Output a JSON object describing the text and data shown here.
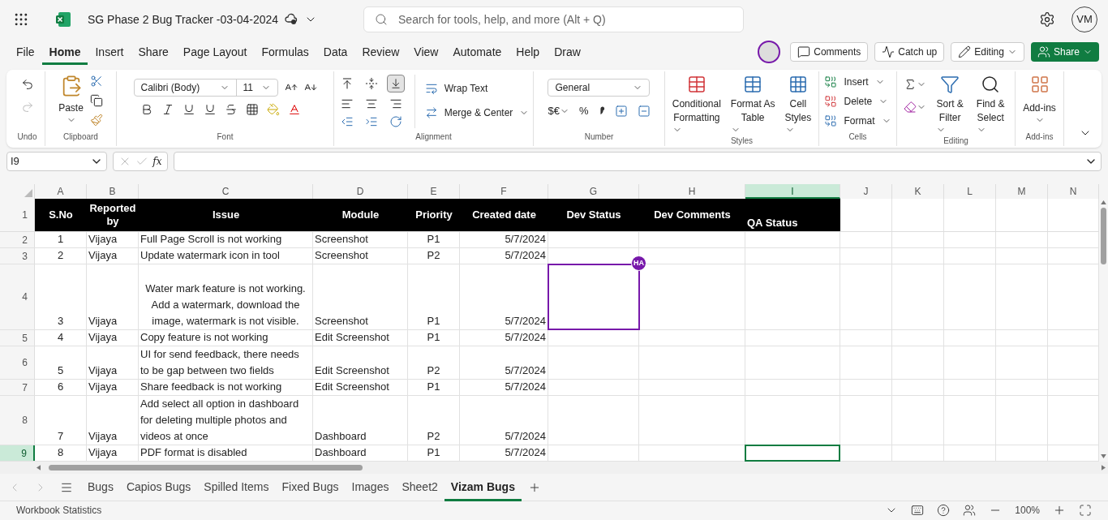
{
  "app": {
    "title": "SG Phase 2 Bug Tracker -03-04-2024",
    "search_placeholder": "Search for tools, help, and more (Alt + Q)",
    "user_initials": "VM"
  },
  "menu": [
    {
      "label": "File",
      "selected": false
    },
    {
      "label": "Home",
      "selected": true
    },
    {
      "label": "Insert",
      "selected": false
    },
    {
      "label": "Share",
      "selected": false
    },
    {
      "label": "Page Layout",
      "selected": false
    },
    {
      "label": "Formulas",
      "selected": false
    },
    {
      "label": "Data",
      "selected": false
    },
    {
      "label": "Review",
      "selected": false
    },
    {
      "label": "View",
      "selected": false
    },
    {
      "label": "Automate",
      "selected": false
    },
    {
      "label": "Help",
      "selected": false
    },
    {
      "label": "Draw",
      "selected": false
    }
  ],
  "actions": {
    "comments": "Comments",
    "catch_up": "Catch up",
    "editing": "Editing",
    "share": "Share"
  },
  "ribbon": {
    "groups": [
      "Undo",
      "Clipboard",
      "Font",
      "Alignment",
      "Number",
      "Styles",
      "Cells",
      "Editing",
      "Add-ins"
    ],
    "paste": "Paste",
    "font_name": "Calibri (Body)",
    "font_size": "11",
    "valign": [
      {
        "selected": false
      },
      {
        "selected": false
      },
      {
        "selected": true
      }
    ],
    "wrap_text": "Wrap Text",
    "merge": "Merge & Center",
    "number_format": "General",
    "currency": "$€",
    "percent": "%",
    "styles": [
      "Conditional\nFormatting",
      "Format As\nTable",
      "Cell\nStyles"
    ],
    "cells": [
      "Insert",
      "Delete",
      "Format"
    ],
    "editing": [
      "Sort &\nFilter",
      "Find &\nSelect"
    ],
    "add_ins": "Add-ins"
  },
  "formula_bar": {
    "name_box": "I9",
    "fx": "fx"
  },
  "sheet": {
    "columns": [
      {
        "letter": "A",
        "selected": false
      },
      {
        "letter": "B",
        "selected": false
      },
      {
        "letter": "C",
        "selected": false
      },
      {
        "letter": "D",
        "selected": false
      },
      {
        "letter": "E",
        "selected": false
      },
      {
        "letter": "F",
        "selected": false
      },
      {
        "letter": "G",
        "selected": false
      },
      {
        "letter": "H",
        "selected": false
      },
      {
        "letter": "I",
        "selected": true
      },
      {
        "letter": "J",
        "selected": false
      },
      {
        "letter": "K",
        "selected": false
      },
      {
        "letter": "L",
        "selected": false
      },
      {
        "letter": "M",
        "selected": false
      },
      {
        "letter": "N",
        "selected": false
      }
    ],
    "header_row": {
      "number": "1",
      "selected": false,
      "cells": [
        "S.No",
        "Reported by",
        "Issue",
        "Module",
        "Priority",
        "Created date",
        "Dev Status",
        "Dev Comments",
        "QA Status"
      ]
    },
    "rows": [
      {
        "number": "2",
        "selected": false,
        "issue_centered": false,
        "sno": "1",
        "reported_by": "Vijaya",
        "issue": "Full Page Scroll is not working",
        "module": "Screenshot",
        "priority": "P1",
        "created": "5/7/2024"
      },
      {
        "number": "3",
        "selected": false,
        "issue_centered": false,
        "sno": "2",
        "reported_by": "Vijaya",
        "issue": "Update watermark icon in tool",
        "module": "Screenshot",
        "priority": "P2",
        "created": "5/7/2024"
      },
      {
        "number": "4",
        "selected": false,
        "issue_centered": true,
        "sno": "3",
        "reported_by": "Vijaya",
        "issue": "Water mark feature is not working. Add a watermark, download the image, watermark is not visible.",
        "module": "Screenshot",
        "priority": "P1",
        "created": "5/7/2024",
        "dev_status_collaborator": {
          "initials": "HA",
          "color": "#7719aa"
        }
      },
      {
        "number": "5",
        "selected": false,
        "issue_centered": false,
        "sno": "4",
        "reported_by": "Vijaya",
        "issue": "Copy feature is not working",
        "module": "Edit Screenshot",
        "priority": "P1",
        "created": "5/7/2024"
      },
      {
        "number": "6",
        "selected": false,
        "issue_centered": false,
        "sno": "5",
        "reported_by": "Vijaya",
        "issue": "UI for send feedback, there needs to be gap between two fields",
        "module": "Edit Screenshot",
        "priority": "P2",
        "created": "5/7/2024"
      },
      {
        "number": "7",
        "selected": false,
        "issue_centered": false,
        "sno": "6",
        "reported_by": "Vijaya",
        "issue": "Share feedback is not working",
        "module": "Edit Screenshot",
        "priority": "P1",
        "created": "5/7/2024"
      },
      {
        "number": "8",
        "selected": false,
        "issue_centered": false,
        "sno": "7",
        "reported_by": "Vijaya",
        "issue": "Add select all option in dashboard for deleting multiple photos and videos at once",
        "module": "Dashboard",
        "priority": "P2",
        "created": "5/7/2024"
      },
      {
        "number": "9",
        "selected": true,
        "issue_centered": false,
        "sno": "8",
        "reported_by": "Vijaya",
        "issue": "PDF format is disabled",
        "module": "Dashboard",
        "priority": "P1",
        "created": "5/7/2024"
      }
    ]
  },
  "sheet_tabs": [
    {
      "label": "Bugs",
      "selected": false
    },
    {
      "label": "Capios Bugs",
      "selected": false
    },
    {
      "label": "Spilled Items",
      "selected": false
    },
    {
      "label": "Fixed Bugs",
      "selected": false
    },
    {
      "label": "Images",
      "selected": false
    },
    {
      "label": "Sheet2",
      "selected": false
    },
    {
      "label": "Vizam Bugs",
      "selected": true
    }
  ],
  "status_bar": {
    "left": "Workbook Statistics",
    "zoom": "100%"
  }
}
